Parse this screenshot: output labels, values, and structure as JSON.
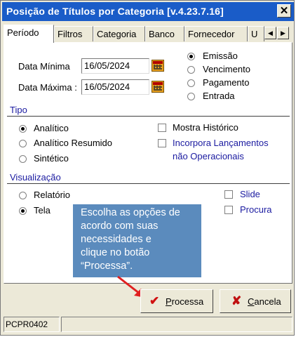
{
  "window": {
    "title": "Posição de Títulos por Categoria [v.4.23.7.16]",
    "close_label": "✕"
  },
  "tabs": [
    {
      "label": "Período"
    },
    {
      "label": "Filtros"
    },
    {
      "label": "Categoria"
    },
    {
      "label": "Banco"
    },
    {
      "label": "Fornecedor"
    },
    {
      "label": "U"
    }
  ],
  "tab_scroll": {
    "left": "◀",
    "right": "▶"
  },
  "periodo": {
    "data_minima_label": "Data Mínima",
    "data_minima_value": "16/05/2024",
    "data_maxima_label": "Data Máxima :",
    "data_maxima_value": "16/05/2024",
    "date_type_options": [
      "Emissão",
      "Vencimento",
      "Pagamento",
      "Entrada"
    ],
    "date_type_selected": "Emissão"
  },
  "tipo": {
    "title": "Tipo",
    "options": [
      "Analítico",
      "Analítico Resumido",
      "Sintético"
    ],
    "selected": "Analítico",
    "mostra_historico": "Mostra Histórico",
    "incorpora_line1": "Incorpora Lançamentos",
    "incorpora_line2": "não Operacionais"
  },
  "visualizacao": {
    "title": "Visualização",
    "options": [
      "Relatório",
      "Tela"
    ],
    "selected": "Tela",
    "slide": "Slide",
    "procura": "Procura"
  },
  "tooltip": {
    "lines": [
      "Escolha as opções de",
      "acordo com suas",
      "necessidades e",
      "clique no botão",
      "“Processa”."
    ]
  },
  "buttons": {
    "processa_first": "P",
    "processa_rest": "rocessa",
    "cancela_first": "C",
    "cancela_rest": "ancela"
  },
  "status": {
    "code": "PCPR0402"
  },
  "colors": {
    "title_bar": "#1a5cc8",
    "tooltip": "#5b8bbd",
    "section_blue": "#1a1aa0",
    "arrow_red": "#e02020",
    "check_red": "#d01010"
  }
}
